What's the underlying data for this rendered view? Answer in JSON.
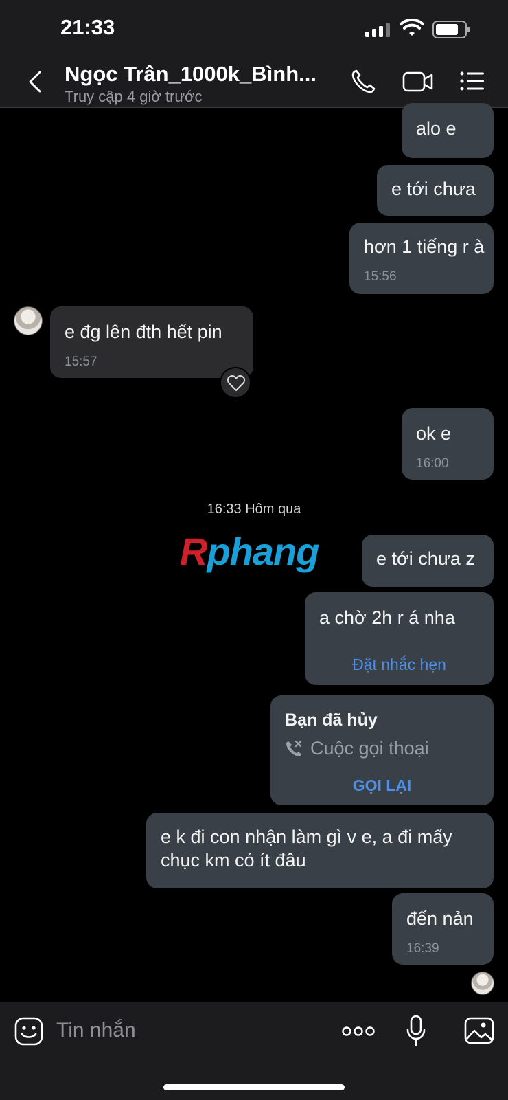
{
  "status": {
    "time": "21:33"
  },
  "header": {
    "title": "Ngọc Trân_1000k_Bình...",
    "subtitle": "Truy cập 4 giờ trước"
  },
  "messages": [
    {
      "text": "alo e"
    },
    {
      "text": "e tới chưa"
    },
    {
      "text": "hơn 1 tiếng r à",
      "time": "15:56"
    },
    {
      "text": "e đg lên đth hết pin",
      "time": "15:57"
    },
    {
      "text": "ok e",
      "time": "16:00"
    },
    {
      "text": "e tới chưa z"
    },
    {
      "text": "a chờ 2h r á nha",
      "action": "Đặt nhắc hẹn"
    },
    {
      "call_title": "Bạn đã hủy",
      "call_type": "Cuộc gọi thoại",
      "action": "GỌI LẠI"
    },
    {
      "line1": "e k đi con nhận làm gì v e, a đi mấy",
      "line2": "chục km có ít đâu"
    },
    {
      "text": "đến nản",
      "time": "16:39"
    }
  ],
  "date_separator": "16:33 Hôm qua",
  "watermark": {
    "part1": "R",
    "part2": "phang",
    "color1": "#d0202a",
    "color2": "#1aa0d8"
  },
  "input": {
    "placeholder": "Tin nhắn"
  },
  "colors": {
    "outgoing_bubble": "#3a4048",
    "incoming_bubble": "#2c2c2e",
    "accent": "#4b8fe8"
  }
}
